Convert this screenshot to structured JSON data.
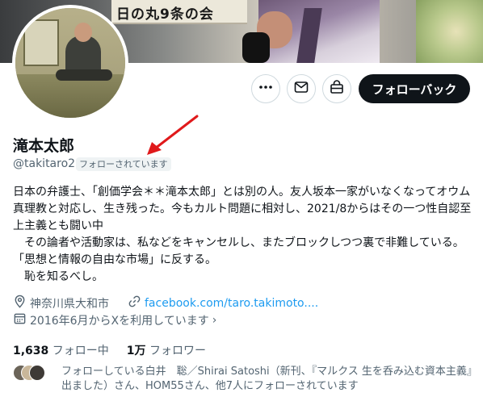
{
  "banner": {
    "sign_text": "日の丸9条の会"
  },
  "actions": {
    "more_icon": "more-icon",
    "message_icon": "mail-icon",
    "shop_icon": "shop-icon",
    "follow_back_label": "フォローバック"
  },
  "profile": {
    "display_name": "滝本太郎",
    "handle": "@takitaro2",
    "follows_you_badge": "フォローされています",
    "bio": "日本の弁護士、「創価学会＊＊滝本太郎」とは別の人。友人坂本一家がいなくなってオウム真理教と対応し、生き残った。今もカルト問題に相対し、2021/8からはその一つ性自認至上主義とも闘い中\n　その論者や活動家は、私などをキャンセルし、またブロックしつつ裏で非難している。「思想と情報の自由な市場」に反する。\n　恥を知るべし。",
    "location": "神奈川県大和市",
    "website": "facebook.com/taro.takimoto....",
    "joined": "2016年6月からXを利用しています",
    "following_count": "1,638",
    "following_label": "フォロー中",
    "followers_count": "1万",
    "followers_label": "フォロワー",
    "followed_by_text": "フォローしている白井　聡／Shirai Satoshi（新刊、『マルクス 生を呑み込む資本主義』出ました）さん、HOM55さん、他7人にフォローされています"
  },
  "colors": {
    "text_primary": "#0f1419",
    "text_secondary": "#536471",
    "link": "#1d9bf0",
    "button_dark": "#0f1419",
    "border": "#cfd9de",
    "annotation_arrow": "#e0191b"
  }
}
